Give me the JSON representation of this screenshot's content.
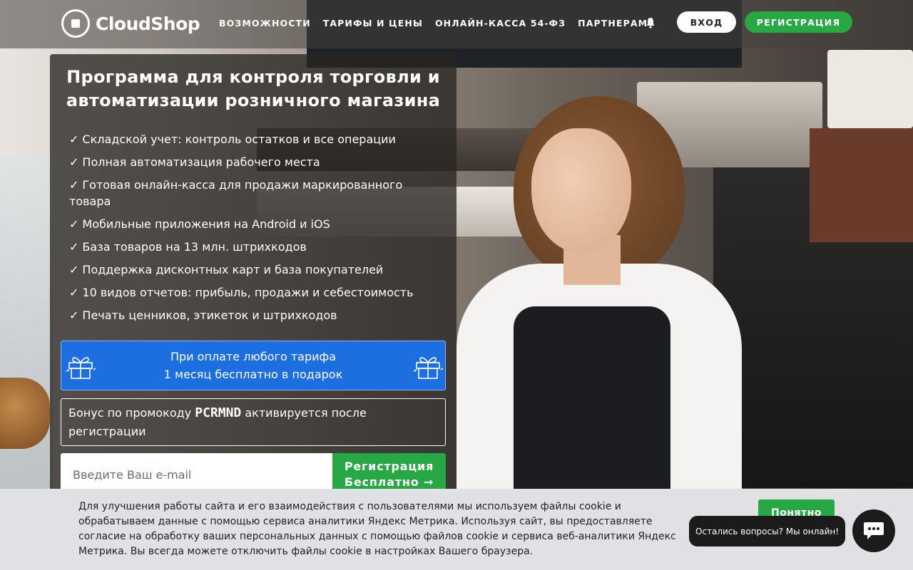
{
  "header": {
    "logo_text": "CloudShop",
    "nav": [
      {
        "label": "ВОЗМОЖНОСТИ"
      },
      {
        "label": "ТАРИФЫ И ЦЕНЫ"
      },
      {
        "label": "ОНЛАЙН-КАССА 54-ФЗ"
      },
      {
        "label": "ПАРТНЕРАМ"
      }
    ],
    "login_label": "ВХОД",
    "register_label": "РЕГИСТРАЦИЯ",
    "bell_icon": "bell-icon"
  },
  "hero": {
    "title": "Программа для контроля торговли и автоматизации розничного магазина",
    "check_glyph": "✓",
    "features": [
      "Складской учет: контроль остатков и все операции",
      "Полная автоматизация рабочего места",
      "Готовая онлайн-касса для продажи маркированного товара",
      "Мобильные приложения на Android и iOS",
      "База товаров на 13 млн. штрихкодов",
      "Поддержка дисконтных карт и база покупателей",
      "10 видов отчетов: прибыль, продажи и себестоимость",
      "Печать ценников, этикеток и штрихкодов"
    ],
    "promo_line1": "При оплате любого тарифа",
    "promo_line2": "1 месяц бесплатно в подарок",
    "bonus_prefix": "Бонус по промокоду ",
    "bonus_code": "PCRMND",
    "bonus_suffix": " активируется после регистрации",
    "email_placeholder": "Введите Ваш e-mail",
    "email_value": "",
    "cta_line1": "Регистрация",
    "cta_line2": "Бесплатно →"
  },
  "cookie": {
    "text": "Для улучшения работы сайта и его взаимодействия с пользователями мы используем файлы cookie и обрабатываем данные с помощью сервиса аналитики Яндекс Метрика. Используя сайт, вы предоставляете согласие на обработку ваших персональных данных с помощью файлов cookie и сервиса веб-аналитики Яндекс Метрика. Вы всегда можете отключить файлы cookie в настройках Вашего браузера.",
    "accept_label": "Понятно"
  },
  "chat": {
    "bubble_text": "Остались вопросы? Мы онлайн!",
    "icon": "chat-icon"
  },
  "colors": {
    "accent_green": "#28a745",
    "promo_blue": "#1d6fe0"
  }
}
